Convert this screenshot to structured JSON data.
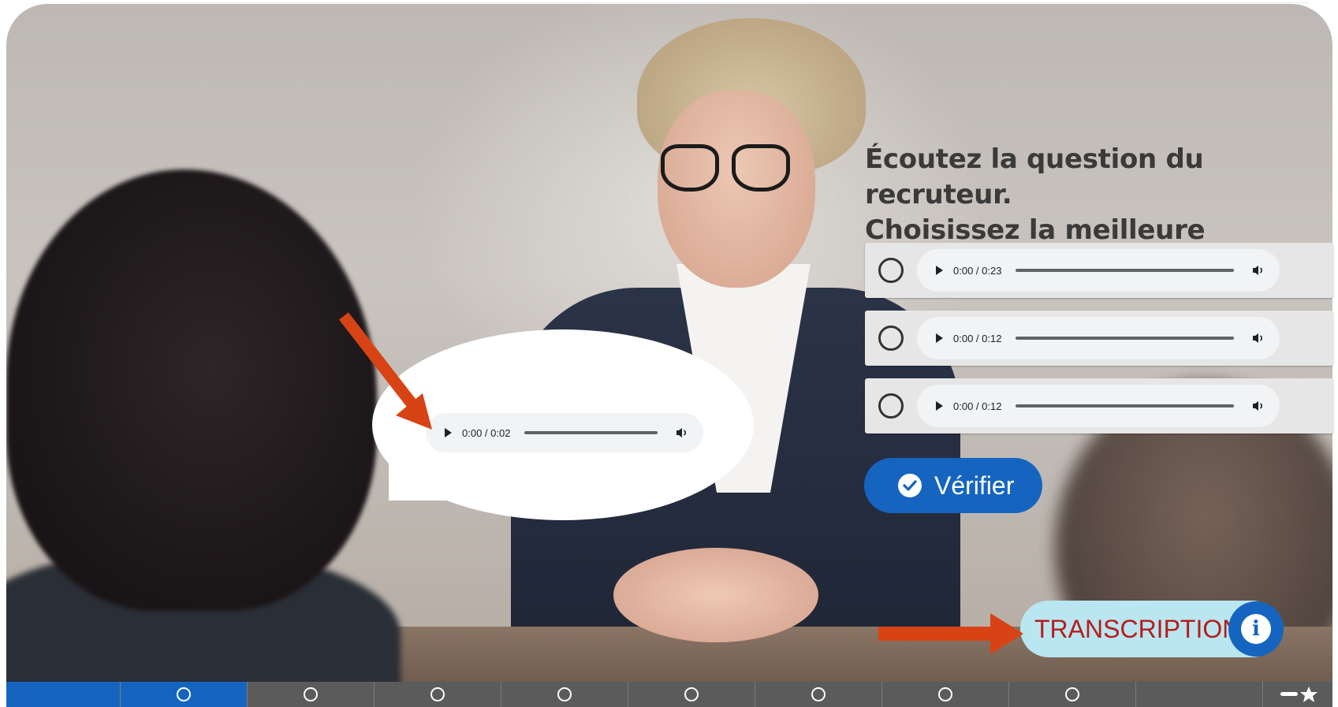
{
  "question": {
    "line1": "Écoutez la question du recruteur.",
    "line2": "Choisissez la meilleure réponse."
  },
  "recruiter_audio": {
    "time": "0:00 / 0:02"
  },
  "options": [
    {
      "time": "0:00 / 0:23"
    },
    {
      "time": "0:00 / 0:12"
    },
    {
      "time": "0:00 / 0:12"
    }
  ],
  "verify_label": "Vérifier",
  "transcription_label": "TRANSCRIPTION",
  "icons": {
    "play": "play-icon",
    "volume": "volume-icon",
    "check": "check-circle-icon",
    "info": "info-icon",
    "arrow": "arrow-icon",
    "menu_star": "menu-star-icon"
  },
  "colors": {
    "accent_blue": "#1565c0",
    "transcription_bg": "#b9e6f0",
    "transcription_text": "#b71c1c",
    "arrow": "#d84315",
    "bar": "#5b5b5b"
  },
  "progress": {
    "total_slides": 11,
    "current_slide": 2
  }
}
